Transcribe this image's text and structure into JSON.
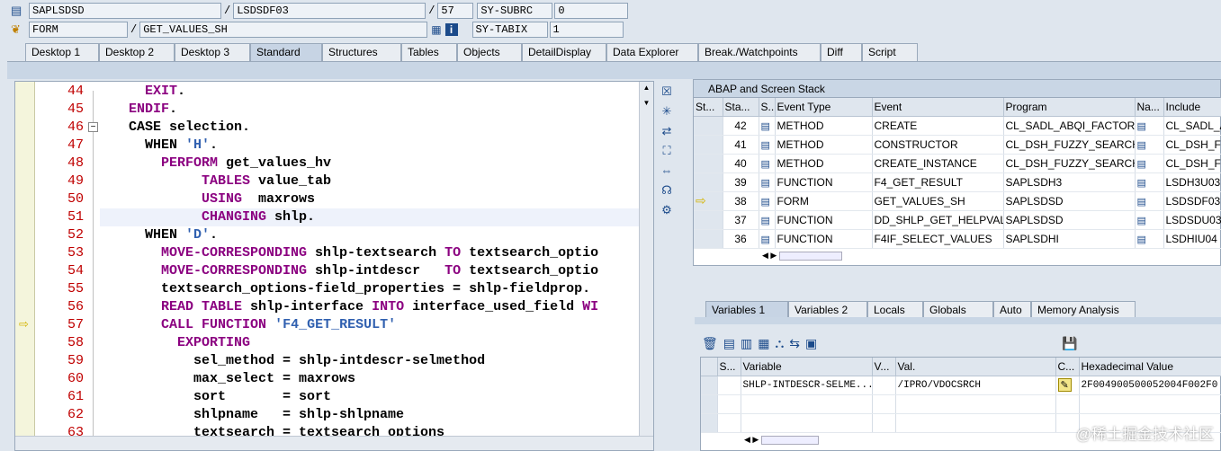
{
  "header": {
    "row1": {
      "program": "SAPLSDSD",
      "include": "LSDSDF03",
      "line": "57",
      "var1_name": "SY-SUBRC",
      "var1_value": "0"
    },
    "row2": {
      "event_type": "FORM",
      "event": "GET_VALUES_SH",
      "var2_name": "SY-TABIX",
      "var2_value": "1"
    },
    "slash": "/"
  },
  "tabs": [
    "Desktop 1",
    "Desktop 2",
    "Desktop 3",
    "Standard",
    "Structures",
    "Tables",
    "Objects",
    "DetailDisplay",
    "Data Explorer",
    "Break./Watchpoints",
    "Diff",
    "Script"
  ],
  "editor": {
    "line_numbers": [
      "44",
      "45",
      "46",
      "47",
      "48",
      "49",
      "50",
      "51",
      "52",
      "53",
      "54",
      "55",
      "56",
      "57",
      "58",
      "59",
      "60",
      "61",
      "62",
      "63"
    ],
    "lines": [
      [
        {
          "t": "    "
        },
        {
          "k": "EXIT"
        },
        {
          "t": "."
        }
      ],
      [
        {
          "t": "  "
        },
        {
          "k": "ENDIF"
        },
        {
          "t": "."
        }
      ],
      [
        {
          "t": "  CASE selection."
        }
      ],
      [
        {
          "t": "    WHEN "
        },
        {
          "s": "'H'"
        },
        {
          "t": "."
        }
      ],
      [
        {
          "t": "      "
        },
        {
          "k": "PERFORM"
        },
        {
          "t": " get_values_hv"
        }
      ],
      [
        {
          "t": "           "
        },
        {
          "k": "TABLES"
        },
        {
          "t": " value_tab"
        }
      ],
      [
        {
          "t": "           "
        },
        {
          "k": "USING"
        },
        {
          "t": "  maxrows"
        }
      ],
      [
        {
          "t": "           "
        },
        {
          "k": "CHANGING"
        },
        {
          "t": " shlp."
        }
      ],
      [
        {
          "t": "    WHEN "
        },
        {
          "s": "'D'"
        },
        {
          "t": "."
        }
      ],
      [
        {
          "t": "      "
        },
        {
          "k": "MOVE-CORRESPONDING"
        },
        {
          "t": " shlp-textsearch "
        },
        {
          "k": "TO"
        },
        {
          "t": " textsearch_optio"
        }
      ],
      [
        {
          "t": "      "
        },
        {
          "k": "MOVE-CORRESPONDING"
        },
        {
          "t": " shlp-intdescr   "
        },
        {
          "k": "TO"
        },
        {
          "t": " textsearch_optio"
        }
      ],
      [
        {
          "t": "      textsearch_options-field_properties = shlp-fieldprop."
        }
      ],
      [
        {
          "t": "      "
        },
        {
          "k": "READ TABLE"
        },
        {
          "t": " shlp-interface "
        },
        {
          "k": "INTO"
        },
        {
          "t": " interface_used_field "
        },
        {
          "k": "WI"
        }
      ],
      [
        {
          "t": "      "
        },
        {
          "k": "CALL FUNCTION"
        },
        {
          "t": " "
        },
        {
          "s": "'F4_GET_RESULT'"
        }
      ],
      [
        {
          "t": "        "
        },
        {
          "k": "EXPORTING"
        }
      ],
      [
        {
          "t": "          sel_method = shlp-intdescr-selmethod"
        }
      ],
      [
        {
          "t": "          max_select = maxrows"
        }
      ],
      [
        {
          "t": "          sort       = sort"
        }
      ],
      [
        {
          "t": "          shlpname   = shlp-shlpname"
        }
      ],
      [
        {
          "t": "          textsearch = textsearch_options"
        }
      ]
    ]
  },
  "stack": {
    "title": "ABAP and Screen Stack",
    "columns": [
      "St...",
      "Sta...",
      "S...",
      "Event Type",
      "Event",
      "Program",
      "Na...",
      "Include"
    ],
    "rows": [
      {
        "level": "42",
        "type": "METHOD",
        "event": "CREATE",
        "program": "CL_SADL_ABQI_FACTOR...",
        "include": "CL_SADL_A"
      },
      {
        "level": "41",
        "type": "METHOD",
        "event": "CONSTRUCTOR",
        "program": "CL_DSH_FUZZY_SEARCH...",
        "include": "CL_DSH_FU"
      },
      {
        "level": "40",
        "type": "METHOD",
        "event": "CREATE_INSTANCE",
        "program": "CL_DSH_FUZZY_SEARCH...",
        "include": "CL_DSH_FU"
      },
      {
        "level": "39",
        "type": "FUNCTION",
        "event": "F4_GET_RESULT",
        "program": "SAPLSDH3",
        "include": "LSDH3U03"
      },
      {
        "level": "38",
        "type": "FORM",
        "event": "GET_VALUES_SH",
        "program": "SAPLSDSD",
        "include": "LSDSDF03"
      },
      {
        "level": "37",
        "type": "FUNCTION",
        "event": "DD_SHLP_GET_HELPVAL...",
        "program": "SAPLSDSD",
        "include": "LSDSDU03"
      },
      {
        "level": "36",
        "type": "FUNCTION",
        "event": "F4IF_SELECT_VALUES",
        "program": "SAPLSDHI",
        "include": "LSDHIU04"
      }
    ]
  },
  "vartabs": [
    "Variables 1",
    "Variables 2",
    "Locals",
    "Globals",
    "Auto",
    "Memory Analysis"
  ],
  "vars": {
    "columns": [
      "S...",
      "Variable",
      "V...",
      "Val.",
      "C...",
      "Hexadecimal Value"
    ],
    "row": {
      "variable": "SHLP-INTDESCR-SELME...",
      "value": "/IPRO/VDOCSRCH",
      "hex": "2F004900500052004F002F0"
    }
  },
  "watermark": "@稀土掘金技术社区"
}
